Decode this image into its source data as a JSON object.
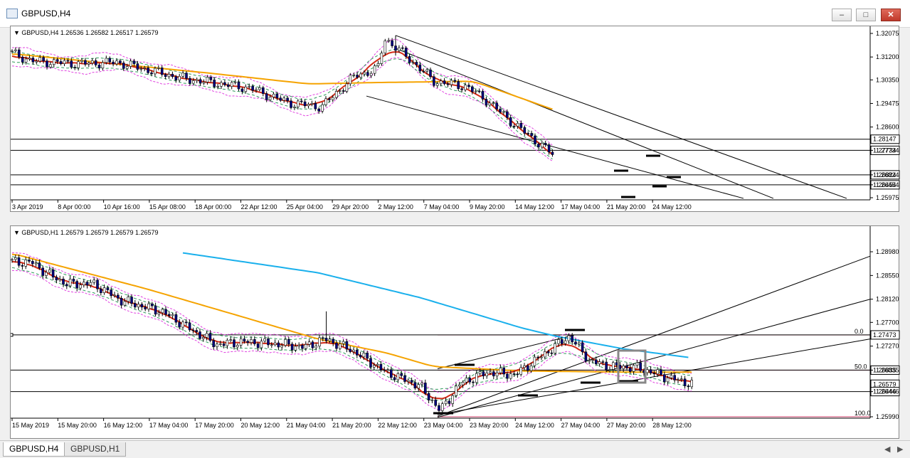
{
  "window": {
    "title": "GBPUSD,H4",
    "min_label": "–",
    "max_label": "□",
    "close_label": "✕"
  },
  "top_chart": {
    "info": "GBPUSD,H4  1.26536  1.26582  1.26517  1.26579",
    "price_ticks": [
      "1.32075",
      "1.31200",
      "1.30350",
      "1.29475",
      "1.28600",
      "1.27734",
      "1.26824",
      "1.26454",
      "1.25975"
    ],
    "price_tick_values": [
      1.32075,
      1.312,
      1.3035,
      1.29475,
      1.286,
      1.27734,
      1.26824,
      1.26454,
      1.25975
    ],
    "level_labels": [
      "1.28147",
      "1.27734",
      "1.26824",
      "1.26454"
    ],
    "time_ticks": [
      "3 Apr 2019",
      "8 Apr 00:00",
      "10 Apr 16:00",
      "15 Apr 08:00",
      "18 Apr 00:00",
      "22 Apr 12:00",
      "25 Apr 04:00",
      "29 Apr 20:00",
      "2 May 12:00",
      "7 May 04:00",
      "9 May 20:00",
      "14 May 12:00",
      "17 May 04:00",
      "21 May 20:00",
      "24 May 12:00"
    ]
  },
  "bottom_chart": {
    "info": "GBPUSD,H1  1.26579  1.26579  1.26579  1.26579",
    "price_ticks": [
      "1.28980",
      "1.28550",
      "1.28120",
      "1.27700",
      "1.27270",
      "1.26835",
      "1.26446",
      "1.25990"
    ],
    "price_tick_values": [
      1.2898,
      1.2855,
      1.2812,
      1.277,
      1.2727,
      1.26835,
      1.26446,
      1.2599
    ],
    "level_labels": [
      "1.27473",
      "1.26835",
      "1.26579",
      "1.26446"
    ],
    "fib_labels": [
      "0.0",
      "50.0",
      "100.0"
    ],
    "time_ticks": [
      "15 May 2019",
      "15 May 20:00",
      "16 May 12:00",
      "17 May 04:00",
      "17 May 20:00",
      "20 May 12:00",
      "21 May 04:00",
      "21 May 20:00",
      "22 May 12:00",
      "23 May 04:00",
      "23 May 20:00",
      "24 May 12:00",
      "27 May 04:00",
      "27 May 20:00",
      "28 May 12:00"
    ]
  },
  "tabs": [
    "GBPUSD,H4",
    "GBPUSD,H1"
  ],
  "colors": {
    "ema_red": "#d22a17",
    "ema_orange": "#f5a300",
    "ma_blue": "#1ab0ec",
    "band_magenta": "#e040e0",
    "band_green": "#2e9a5a",
    "candle_blue": "#000080",
    "fib_red": "#c0003a"
  }
}
